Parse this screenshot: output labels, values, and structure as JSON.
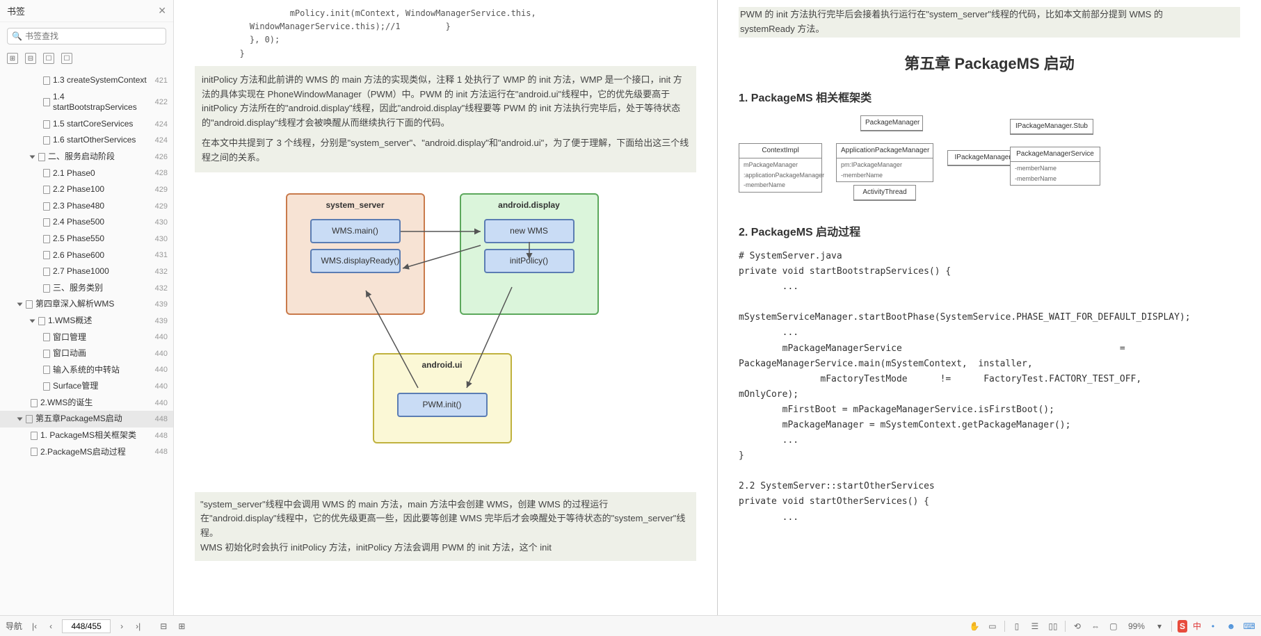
{
  "sidebar": {
    "title": "书签",
    "search_placeholder": "书签查找",
    "items": [
      {
        "label": "1.3 createSystemContext",
        "page": "421",
        "pad": 3,
        "leaf": true
      },
      {
        "label": "1.4 startBootstrapServices",
        "page": "422",
        "pad": 3,
        "leaf": true
      },
      {
        "label": "1.5 startCoreServices",
        "page": "424",
        "pad": 3,
        "leaf": true
      },
      {
        "label": "1.6 startOtherServices",
        "page": "424",
        "pad": 3,
        "leaf": true
      },
      {
        "label": "二、服务启动阶段",
        "page": "426",
        "pad": 2,
        "leaf": false,
        "open": true
      },
      {
        "label": "2.1 Phase0",
        "page": "428",
        "pad": 3,
        "leaf": true
      },
      {
        "label": "2.2 Phase100",
        "page": "429",
        "pad": 3,
        "leaf": true
      },
      {
        "label": "2.3 Phase480",
        "page": "429",
        "pad": 3,
        "leaf": true
      },
      {
        "label": "2.4 Phase500",
        "page": "430",
        "pad": 3,
        "leaf": true
      },
      {
        "label": "2.5 Phase550",
        "page": "430",
        "pad": 3,
        "leaf": true
      },
      {
        "label": "2.6 Phase600",
        "page": "431",
        "pad": 3,
        "leaf": true
      },
      {
        "label": "2.7 Phase1000",
        "page": "432",
        "pad": 3,
        "leaf": true
      },
      {
        "label": "三、服务类别",
        "page": "432",
        "pad": 3,
        "leaf": true
      },
      {
        "label": "第四章深入解析WMS",
        "page": "439",
        "pad": 1,
        "leaf": false,
        "open": true
      },
      {
        "label": "1.WMS概述",
        "page": "439",
        "pad": 2,
        "leaf": false,
        "open": true
      },
      {
        "label": "窗口管理",
        "page": "440",
        "pad": 3,
        "leaf": true
      },
      {
        "label": "窗口动画",
        "page": "440",
        "pad": 3,
        "leaf": true
      },
      {
        "label": "输入系统的中转站",
        "page": "440",
        "pad": 3,
        "leaf": true
      },
      {
        "label": "Surface管理",
        "page": "440",
        "pad": 3,
        "leaf": true
      },
      {
        "label": "2.WMS的诞生",
        "page": "440",
        "pad": 2,
        "leaf": true
      },
      {
        "label": "第五章PackageMS启动",
        "page": "448",
        "pad": 1,
        "leaf": false,
        "open": true,
        "selected": true
      },
      {
        "label": "1. PackageMS相关框架类",
        "page": "448",
        "pad": 2,
        "leaf": true
      },
      {
        "label": "2.PackageMS启动过程",
        "page": "448",
        "pad": 2,
        "leaf": true
      }
    ]
  },
  "left_page": {
    "code": "            mPolicy.init(mContext, WindowManagerService.this,\n    WindowManagerService.this);//1         }\n    }, 0);\n  }",
    "para1": "initPolicy 方法和此前讲的 WMS 的 main 方法的实现类似，注释 1 处执行了 WMP 的 init 方法，WMP 是一个接口，init 方法的具体实现在 PhoneWindowManager（PWM）中。PWM 的 init 方法运行在\"android.ui\"线程中，它的优先级要高于 initPolicy 方法所在的\"android.display\"线程，因此\"android.display\"线程要等 PWM 的 init 方法执行完毕后，处于等待状态的\"android.display\"线程才会被唤醒从而继续执行下面的代码。",
    "para2": "在本文中共提到了 3 个线程，分别是\"system_server\"、\"android.display\"和\"android.ui\"，为了便于理解，下面给出这三个线程之间的关系。",
    "diagram": {
      "sys_title": "system_server",
      "sys_n1": "WMS.main()",
      "sys_n2": "WMS.displayReady()",
      "disp_title": "android.display",
      "disp_n1": "new WMS",
      "disp_n2": "initPolicy()",
      "ui_title": "android.ui",
      "ui_n1": "PWM.init()"
    },
    "bottom": "\"system_server\"线程中会调用 WMS 的 main 方法，main 方法中会创建 WMS，创建 WMS 的过程运行在\"android.display\"线程中，它的优先级更高一些，因此要等创建 WMS 完毕后才会唤醒处于等待状态的\"system_server\"线程。\nWMS 初始化时会执行 initPolicy 方法，initPolicy 方法会调用 PWM 的 init 方法，这个 init"
  },
  "right_page": {
    "top": "PWM 的 init 方法执行完毕后会接着执行运行在\"system_server\"线程的代码，比如本文前部分提到 WMS 的\nsystemReady 方法。",
    "chapter_title": "第五章 PackageMS 启动",
    "sec1": "1.  PackageMS 相关框架类",
    "uml": {
      "b1": {
        "title": "ContextImpl",
        "body": "mPackageManager\n:applicationPackageManager\n-memberName"
      },
      "b2": {
        "title": "PackageManager"
      },
      "b3": {
        "title": "ApplicationPackageManager",
        "body": "pm:IPackageManager\n-memberName"
      },
      "b4": {
        "title": "ActivityThread"
      },
      "b5": {
        "title": "IPackageManager.Proxy"
      },
      "b6": {
        "title": "IPackageManager.Stub"
      },
      "b7": {
        "title": "PackageManagerService",
        "body": "-memberName\n-memberName"
      }
    },
    "sec2": "2. PackageMS 启动过程",
    "code": "# SystemServer.java\nprivate void startBootstrapServices() {\n        ...\n\nmSystemServiceManager.startBootPhase(SystemService.PHASE_WAIT_FOR_DEFAULT_DISPLAY);\n        ...\n        mPackageManagerService                                        =\nPackageManagerService.main(mSystemContext,  installer,\n               mFactoryTestMode      !=      FactoryTest.FACTORY_TEST_OFF,\nmOnlyCore);\n        mFirstBoot = mPackageManagerService.isFirstBoot();\n        mPackageManager = mSystemContext.getPackageManager();\n        ...\n}\n\n2.2 SystemServer::startOtherServices\nprivate void startOtherServices() {\n        ..."
  },
  "footer": {
    "nav_label": "导航",
    "page": "448/455",
    "zoom": "99%",
    "ime": "中"
  }
}
